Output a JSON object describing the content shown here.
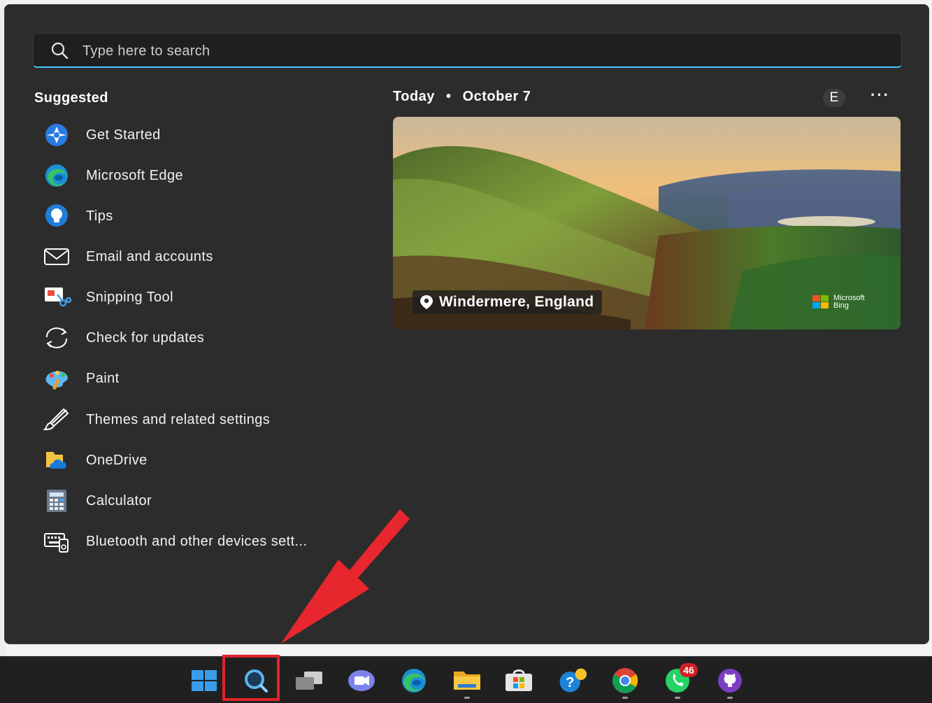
{
  "search": {
    "placeholder": "Type here to search"
  },
  "suggested": {
    "title": "Suggested",
    "items": [
      {
        "label": "Get Started"
      },
      {
        "label": "Microsoft Edge"
      },
      {
        "label": "Tips"
      },
      {
        "label": "Email and accounts"
      },
      {
        "label": "Snipping Tool"
      },
      {
        "label": "Check for updates"
      },
      {
        "label": "Paint"
      },
      {
        "label": "Themes and related settings"
      },
      {
        "label": "OneDrive"
      },
      {
        "label": "Calculator"
      },
      {
        "label": "Bluetooth and other devices sett..."
      }
    ]
  },
  "today": {
    "label": "Today",
    "date": "October 7",
    "avatar": "E",
    "more": "···",
    "location": "Windermere, England",
    "bing_line1": "Microsoft",
    "bing_line2": "Bing"
  },
  "taskbar": {
    "whatsapp_badge": "46"
  },
  "colors": {
    "accent": "#4cc2ff",
    "highlight": "#e2212b",
    "panel": "#2c2c2c"
  }
}
